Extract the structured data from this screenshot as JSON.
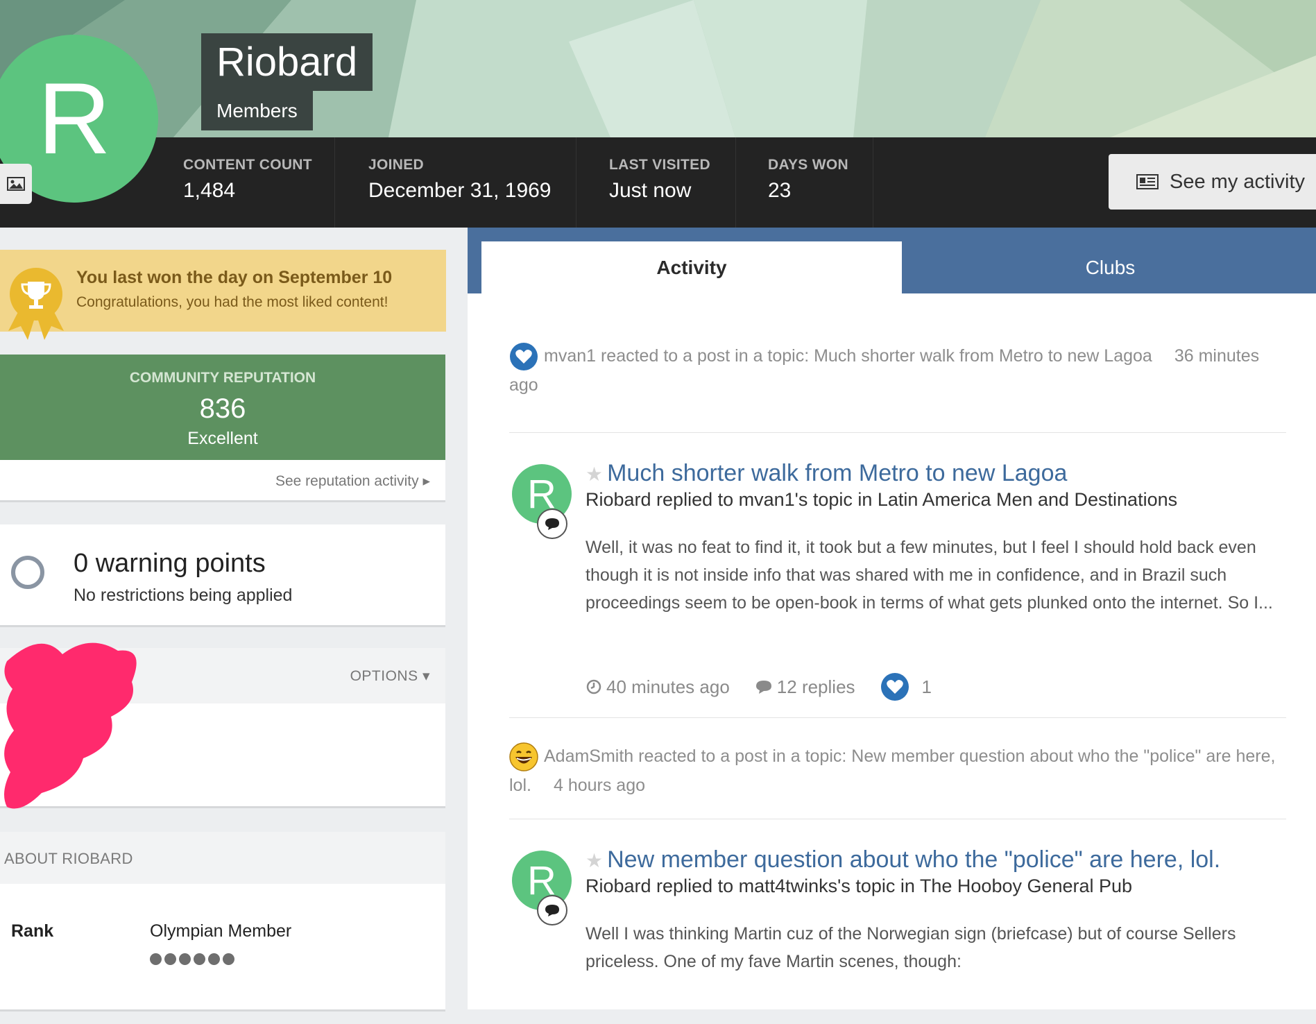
{
  "profile": {
    "avatar_letter": "R",
    "name": "Riobard",
    "group": "Members",
    "brand_green": "#5cc47f"
  },
  "stats": [
    {
      "label": "CONTENT COUNT",
      "value": "1,484"
    },
    {
      "label": "JOINED",
      "value": "December 31, 1969"
    },
    {
      "label": "LAST VISITED",
      "value": "Just now"
    },
    {
      "label": "DAYS WON",
      "value": "23"
    }
  ],
  "activity_button": {
    "label": "See my activity",
    "icon": "newspaper-icon"
  },
  "day_won": {
    "title": "You last won the day on September 10",
    "text": "Congratulations, you had the most liked content!",
    "icon": "trophy-icon"
  },
  "reputation": {
    "label": "COMMUNITY REPUTATION",
    "value": "836",
    "level": "Excellent",
    "link": "See reputation activity"
  },
  "warnings": {
    "title": "0 warning points",
    "text": "No restrictions being applied"
  },
  "options_label": "OPTIONS",
  "about": {
    "heading": "ABOUT RIOBARD",
    "rank_label": "Rank",
    "rank_value": "Olympian Member",
    "rank_pips": 6
  },
  "tabs": [
    {
      "label": "Activity",
      "active": true
    },
    {
      "label": "Clubs",
      "active": false
    }
  ],
  "feed": {
    "reaction1": {
      "icon": "heart-icon",
      "text": "mvan1 reacted to a post in a topic: Much shorter walk from Metro to new Lagoa",
      "time": "36 minutes ago"
    },
    "post1": {
      "avatar_letter": "R",
      "title": "Much shorter walk from Metro to new Lagoa",
      "subtitle": "Riobard replied to mvan1's topic in Latin America Men and Destinations",
      "body": "Well, it was no feat to find it, it took but a few minutes, but I feel I should hold back even though it is not inside info that was shared with me in confidence, and in Brazil such proceedings seem to be open-book in terms of what gets plunked onto the internet. So I...",
      "time": "40 minutes ago",
      "replies": "12 replies",
      "reactions": "1"
    },
    "reaction2": {
      "icon": "laughing-emoji-icon",
      "text": "AdamSmith reacted to a post in a topic: New member question about who the \"police\" are here, lol.",
      "time": "4 hours ago"
    },
    "post2": {
      "avatar_letter": "R",
      "title": "New member question about who the \"police\" are here, lol.",
      "subtitle": "Riobard replied to matt4twinks's topic in The Hooboy General Pub",
      "body": "Well I was thinking Martin cuz of the Norwegian sign (briefcase) but of course Sellers priceless. One of my fave Martin scenes, though:"
    }
  }
}
